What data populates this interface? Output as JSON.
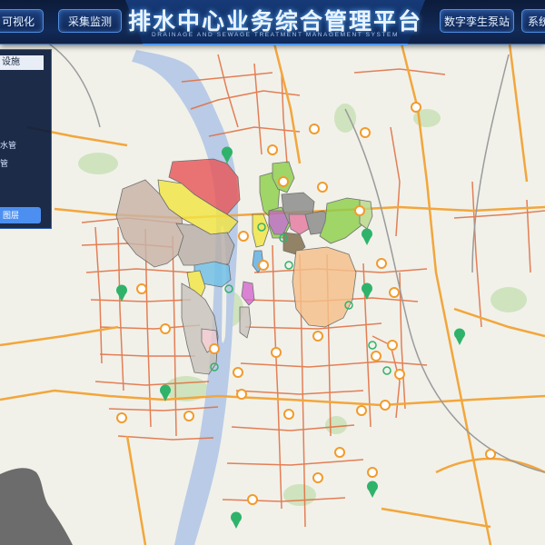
{
  "header": {
    "title": "排水中心业务综合管理平台",
    "subtitle": "DRAINAGE AND SEWAGE TREATMENT MANAGEMENT SYSTEM",
    "nav_left": [
      "可视化",
      "采集监测"
    ],
    "nav_right": [
      "数字孪生泵站",
      "系统"
    ]
  },
  "layer_panel": {
    "header": "设施",
    "items": [
      "水管",
      "管"
    ],
    "button": "图层"
  },
  "colors": {
    "header_bg": "#0c1b3a",
    "accent": "#4f9bff",
    "river": "#b5c8e6",
    "road_major": "#f2a23a",
    "road_minor": "#e8723a",
    "marker_green": "#2fb36a",
    "marker_orange": "#f29b2c"
  },
  "map": {
    "icons": [
      "pump-station-marker-icon",
      "facility-marker-icon"
    ]
  }
}
